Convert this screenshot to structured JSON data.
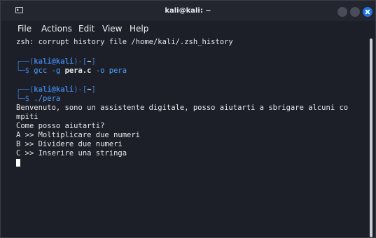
{
  "window": {
    "title": "kali@kali: ~"
  },
  "menu": [
    "File",
    "Actions",
    "Edit",
    "View",
    "Help"
  ],
  "terminal": {
    "line1": "zsh: corrupt history file /home/kali/.zsh_history",
    "prompt_user": "kali",
    "prompt_at": "@",
    "prompt_host": "kali",
    "prompt_dir": "~",
    "cmd1_part1": "gcc -g ",
    "cmd1_file": "pera.c",
    "cmd1_part2": " -o pera",
    "cmd2": "./pera",
    "out1": "Benvenuto, sono un assistente digitale, posso aiutarti a sbrigare alcuni co",
    "out2": "mpiti",
    "out3": "Come posso aiutarti?",
    "out4": "A >> Moltiplicare due numeri",
    "out5": "B >> Dividere due numeri",
    "out6": "C >> Inserire una stringa"
  }
}
